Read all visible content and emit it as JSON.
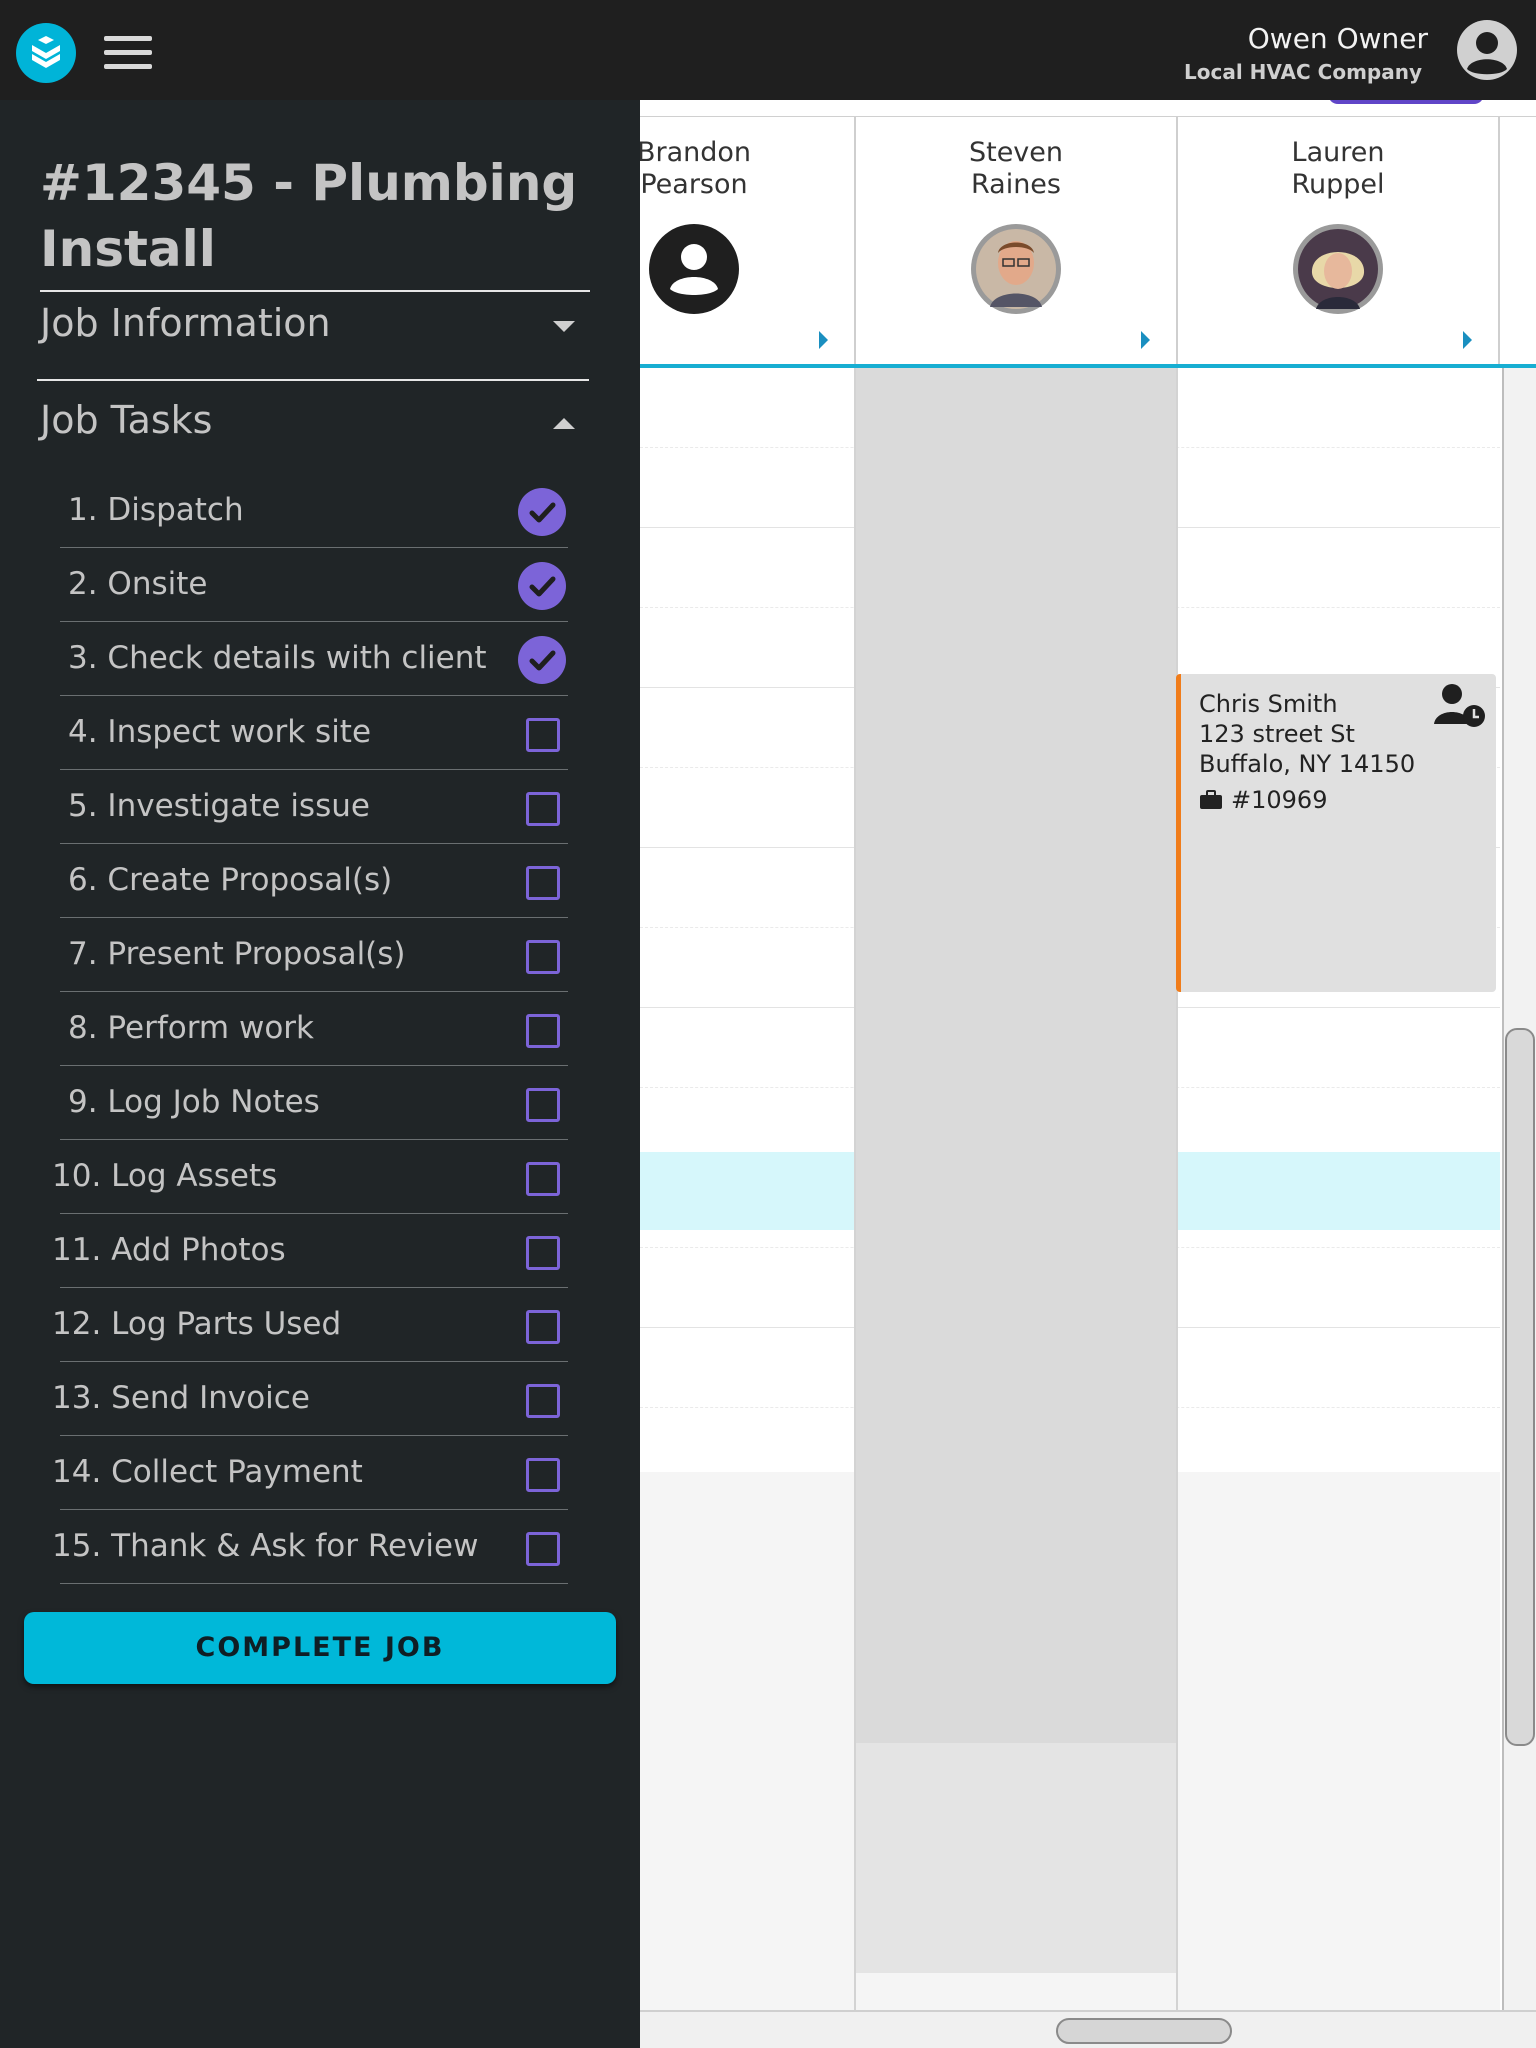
{
  "topbar": {
    "user_name": "Owen Owner",
    "company": "Local HVAC Company",
    "logo_icon": "app-logo-icon",
    "menu_icon": "hamburger-menu-icon",
    "avatar_icon": "user-avatar-icon"
  },
  "sidebar": {
    "job_title": "#12345 - Plumbing Install",
    "sections": {
      "job_information": "Job Information",
      "job_tasks": "Job Tasks"
    },
    "tasks": [
      {
        "label": "1. Dispatch",
        "done": true
      },
      {
        "label": "2. Onsite",
        "done": true
      },
      {
        "label": "3. Check details with client",
        "done": true
      },
      {
        "label": "4. Inspect work site",
        "done": false
      },
      {
        "label": "5. Investigate issue",
        "done": false
      },
      {
        "label": "6. Create Proposal(s)",
        "done": false
      },
      {
        "label": "7. Present Proposal(s)",
        "done": false
      },
      {
        "label": "8. Perform work",
        "done": false
      },
      {
        "label": "9. Log Job Notes",
        "done": false
      },
      {
        "label": "10. Log Assets",
        "done": false
      },
      {
        "label": "11. Add Photos",
        "done": false
      },
      {
        "label": "12. Log Parts Used",
        "done": false
      },
      {
        "label": "13. Send Invoice",
        "done": false
      },
      {
        "label": "14. Collect Payment",
        "done": false
      },
      {
        "label": "15. Thank & Ask for Review",
        "done": false
      }
    ],
    "complete_button": "COMPLETE JOB"
  },
  "schedule": {
    "technicians": [
      {
        "name": "Brandon Pearson",
        "avatar": "default-person-icon"
      },
      {
        "name": "Steven Raines",
        "avatar": "photo"
      },
      {
        "name": "Lauren Ruppel",
        "avatar": "photo"
      }
    ],
    "appointment": {
      "customer": "Chris Smith",
      "street": "123 street St",
      "city": "Buffalo, NY 14150",
      "job_number": "#10969",
      "icon": "person-clock-icon",
      "job_icon": "briefcase-icon"
    }
  },
  "colors": {
    "accent_cyan": "#00b8d9",
    "accent_purple": "#7c64d8",
    "appointment_border": "#f07c1a",
    "sidebar_bg": "#202527",
    "topbar_bg": "#1f1f1f"
  }
}
